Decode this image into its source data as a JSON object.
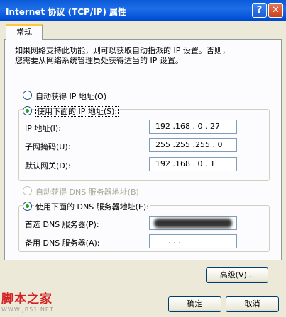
{
  "window": {
    "title": "Internet 协议 (TCP/IP) 属性",
    "help_label": "?",
    "close_label": "✕"
  },
  "tab": {
    "label": "常规"
  },
  "description": {
    "line1": "如果网络支持此功能，则可以获取自动指派的 IP 设置。否则，",
    "line2": "您需要从网络系统管理员处获得适当的 IP 设置。"
  },
  "ip_settings": {
    "auto_label": "自动获得 IP 地址(O)",
    "manual_label": "使用下面的 IP 地址(S):",
    "selected": "manual",
    "ip_address_label": "IP 地址(I):",
    "ip_address_value": "192 .168 . 0 . 27",
    "subnet_label": "子网掩码(U):",
    "subnet_value": "255 .255 .255 . 0",
    "gateway_label": "默认网关(D):",
    "gateway_value": "192 .168 . 0 . 1"
  },
  "dns_settings": {
    "auto_label": "自动获得 DNS 服务器地址(B)",
    "manual_label": "使用下面的 DNS 服务器地址(E):",
    "selected": "manual",
    "preferred_label": "首选 DNS 服务器(P):",
    "preferred_value": "",
    "alternate_label": "备用 DNS 服务器(A):",
    "alternate_value": ".     .     ."
  },
  "buttons": {
    "advanced": "高级(V)...",
    "ok": "确定",
    "cancel": "取消"
  },
  "watermark": {
    "main": "脚本之家",
    "sub": "WWW.JB51.NET"
  },
  "colors": {
    "titlebar": "#0a5ad9",
    "dialog_bg": "#ece9d8",
    "tab_highlight": "#ffc83c",
    "radio_dot": "#21a121",
    "watermark": "#d42020"
  }
}
